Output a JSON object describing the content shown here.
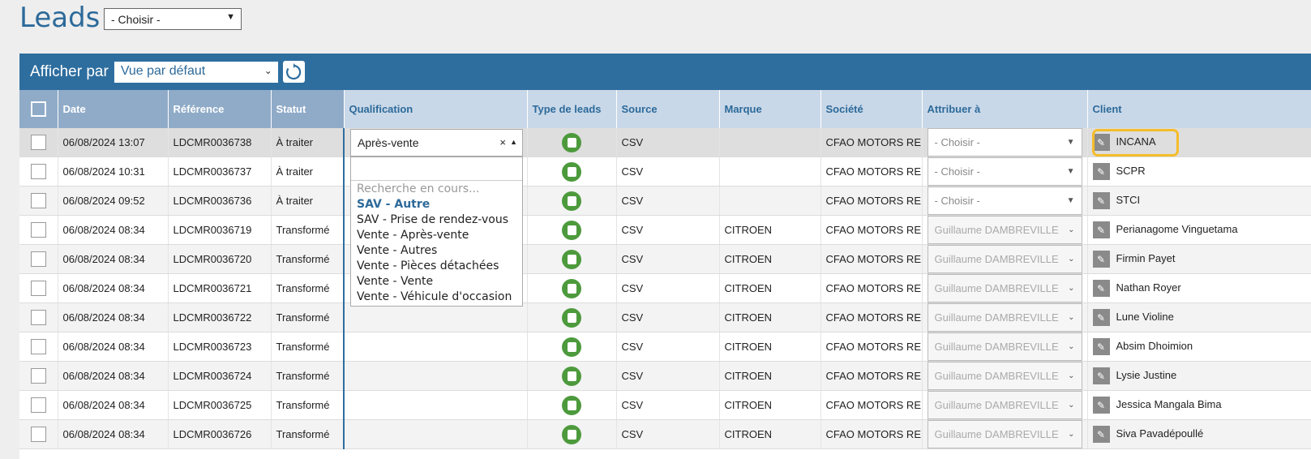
{
  "page": {
    "title": "Leads",
    "top_select": "- Choisir -"
  },
  "toolbar": {
    "afficher_label": "Afficher par",
    "view_select": "Vue par défaut"
  },
  "columns": {
    "date": "Date",
    "reference": "Référence",
    "statut": "Statut",
    "qualification": "Qualification",
    "type": "Type de leads",
    "source": "Source",
    "marque": "Marque",
    "societe": "Société",
    "attribuer": "Attribuer à",
    "client": "Client"
  },
  "rows": [
    {
      "date": "06/08/2024 13:07",
      "ref": "LDCMR0036738",
      "statut": "À traiter",
      "source": "CSV",
      "marque": "",
      "societe": "CFAO MOTORS REI",
      "attribuer": "- Choisir -",
      "client": "INCANA"
    },
    {
      "date": "06/08/2024 10:31",
      "ref": "LDCMR0036737",
      "statut": "À traiter",
      "source": "CSV",
      "marque": "",
      "societe": "CFAO MOTORS REI",
      "attribuer": "- Choisir -",
      "client": "SCPR"
    },
    {
      "date": "06/08/2024 09:52",
      "ref": "LDCMR0036736",
      "statut": "À traiter",
      "source": "CSV",
      "marque": "",
      "societe": "CFAO MOTORS REI",
      "attribuer": "- Choisir -",
      "client": "STCI"
    },
    {
      "date": "06/08/2024 08:34",
      "ref": "LDCMR0036719",
      "statut": "Transformé",
      "source": "CSV",
      "marque": "CITROEN",
      "societe": "CFAO MOTORS REI",
      "attribuer": "Guillaume DAMBREVILLE",
      "client": "Perianagome Vinguetama"
    },
    {
      "date": "06/08/2024 08:34",
      "ref": "LDCMR0036720",
      "statut": "Transformé",
      "source": "CSV",
      "marque": "CITROEN",
      "societe": "CFAO MOTORS REI",
      "attribuer": "Guillaume DAMBREVILLE",
      "client": "Firmin Payet"
    },
    {
      "date": "06/08/2024 08:34",
      "ref": "LDCMR0036721",
      "statut": "Transformé",
      "source": "CSV",
      "marque": "CITROEN",
      "societe": "CFAO MOTORS REI",
      "attribuer": "Guillaume DAMBREVILLE",
      "client": "Nathan Royer"
    },
    {
      "date": "06/08/2024 08:34",
      "ref": "LDCMR0036722",
      "statut": "Transformé",
      "source": "CSV",
      "marque": "CITROEN",
      "societe": "CFAO MOTORS REI",
      "attribuer": "Guillaume DAMBREVILLE",
      "client": "Lune Violine"
    },
    {
      "date": "06/08/2024 08:34",
      "ref": "LDCMR0036723",
      "statut": "Transformé",
      "source": "CSV",
      "marque": "CITROEN",
      "societe": "CFAO MOTORS REI",
      "attribuer": "Guillaume DAMBREVILLE",
      "client": "Absim Dhoimion"
    },
    {
      "date": "06/08/2024 08:34",
      "ref": "LDCMR0036724",
      "statut": "Transformé",
      "source": "CSV",
      "marque": "CITROEN",
      "societe": "CFAO MOTORS REI",
      "attribuer": "Guillaume DAMBREVILLE",
      "client": "Lysie Justine"
    },
    {
      "date": "06/08/2024 08:34",
      "ref": "LDCMR0036725",
      "statut": "Transformé",
      "source": "CSV",
      "marque": "CITROEN",
      "societe": "CFAO MOTORS REI",
      "attribuer": "Guillaume DAMBREVILLE",
      "client": "Jessica Mangala Bima"
    },
    {
      "date": "06/08/2024 08:34",
      "ref": "LDCMR0036726",
      "statut": "Transformé",
      "source": "CSV",
      "marque": "CITROEN",
      "societe": "CFAO MOTORS REI",
      "attribuer": "Guillaume DAMBREVILLE",
      "client": "Siva Pavadépoullé"
    }
  ],
  "qualification_select": {
    "value": "Après-vente"
  },
  "dropdown": {
    "loading": "Recherche en cours...",
    "options": [
      "SAV - Autre",
      "SAV - Prise de rendez-vous",
      "Vente - Après-vente",
      "Vente - Autres",
      "Vente - Pièces détachées",
      "Vente - Vente",
      "Vente - Véhicule d'occasion"
    ]
  },
  "colors": {
    "header": "#2e6e9f",
    "highlight": "#f4bd2a",
    "type_icon": "#4d9a3d"
  },
  "icons": {
    "type": "excel-icon",
    "edit": "pencil-icon",
    "refresh": "refresh-icon"
  }
}
